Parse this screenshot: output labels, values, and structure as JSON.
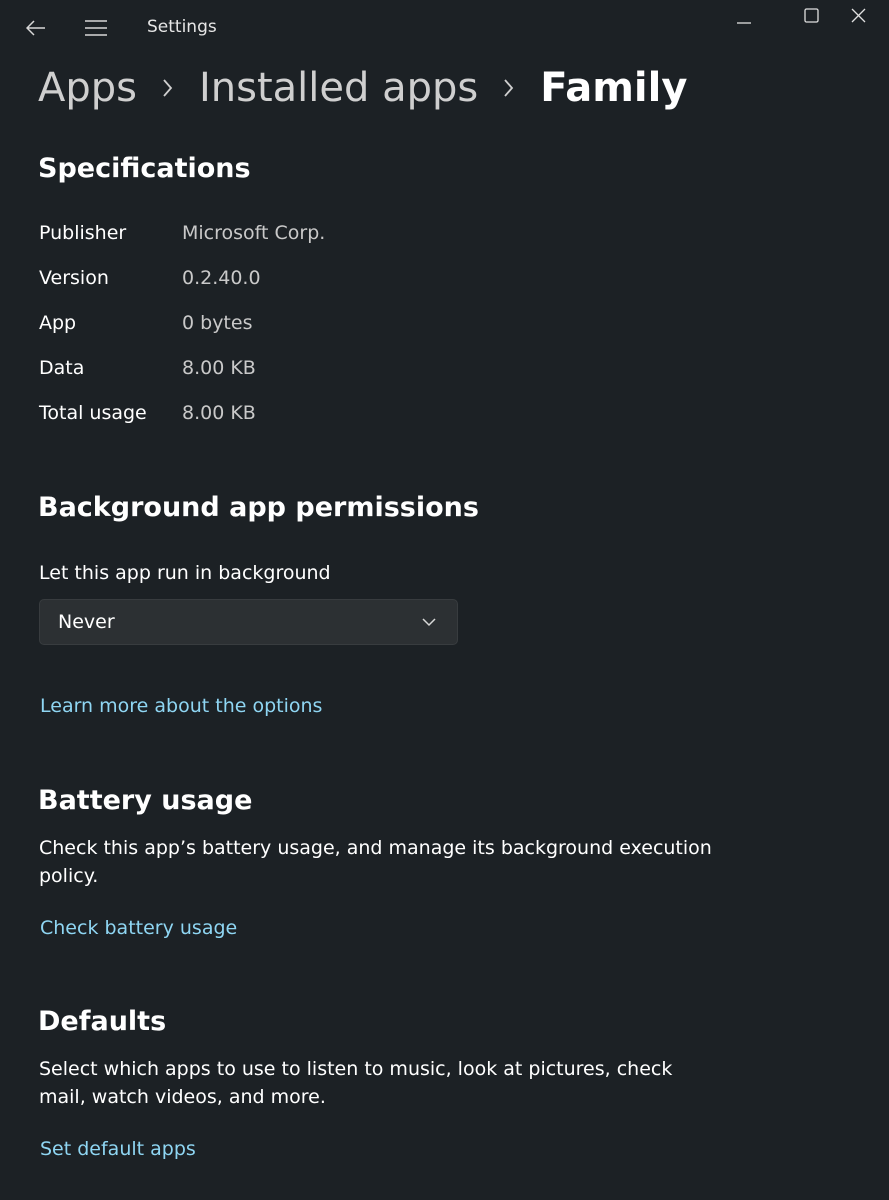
{
  "window": {
    "title": "Settings"
  },
  "breadcrumb": {
    "items": [
      "Apps",
      "Installed apps",
      "Family"
    ]
  },
  "specifications": {
    "title": "Specifications",
    "rows": [
      {
        "label": "Publisher",
        "value": "Microsoft Corp."
      },
      {
        "label": "Version",
        "value": "0.2.40.0"
      },
      {
        "label": "App",
        "value": "0 bytes"
      },
      {
        "label": "Data",
        "value": "8.00 KB"
      },
      {
        "label": "Total usage",
        "value": "8.00 KB"
      }
    ]
  },
  "background_permissions": {
    "title": "Background app permissions",
    "field_label": "Let this app run in background",
    "selected_option": "Never",
    "link": "Learn more about the options"
  },
  "battery": {
    "title": "Battery usage",
    "description": "Check this app’s battery usage, and manage its background execution policy.",
    "link": "Check battery usage"
  },
  "defaults": {
    "title": "Defaults",
    "description": "Select which apps to use to listen to music, look at pictures, check mail, watch videos, and more.",
    "link": "Set default apps"
  },
  "colors": {
    "background": "#1c2125",
    "link": "#8fd6f3",
    "secondary_text": "#c9c9c9"
  }
}
